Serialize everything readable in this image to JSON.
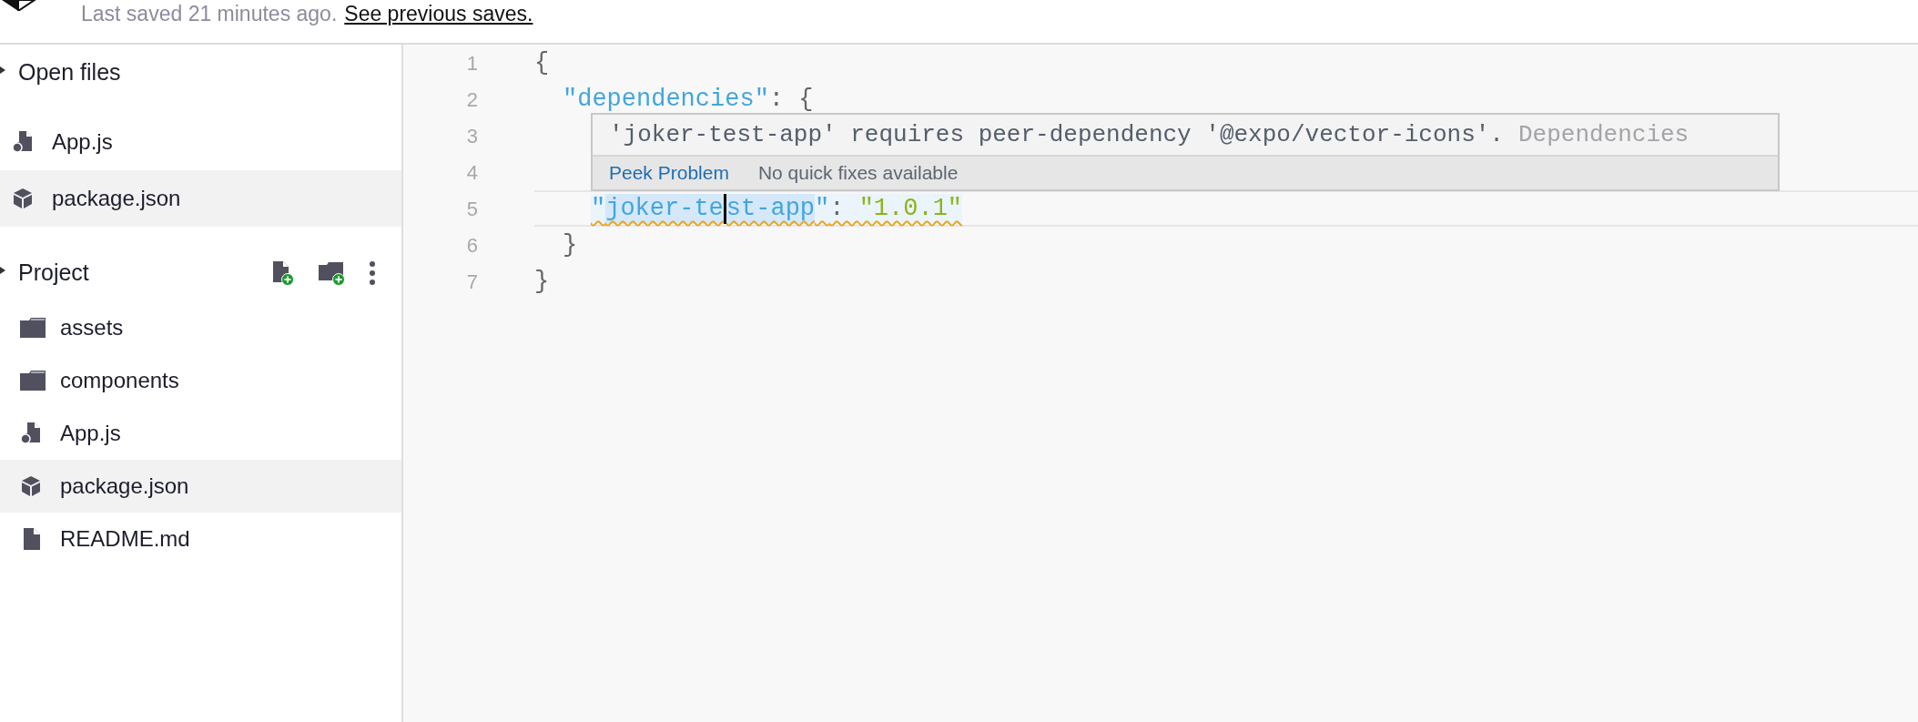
{
  "header": {
    "status": "Last saved 21 minutes ago.",
    "link": "See previous saves."
  },
  "sidebar": {
    "sections": [
      {
        "title": "Open files",
        "kind": "open_files",
        "items": [
          {
            "name": "App.js",
            "kind": "js",
            "selected": false
          },
          {
            "name": "package.json",
            "kind": "package",
            "selected": true
          }
        ]
      },
      {
        "title": "Project",
        "kind": "project",
        "items": [
          {
            "name": "assets",
            "kind": "folder",
            "selected": false
          },
          {
            "name": "components",
            "kind": "folder",
            "selected": false
          },
          {
            "name": "App.js",
            "kind": "js",
            "selected": false
          },
          {
            "name": "package.json",
            "kind": "package",
            "selected": true
          },
          {
            "name": "README.md",
            "kind": "file",
            "selected": false
          }
        ]
      }
    ]
  },
  "editor": {
    "lines": [
      {
        "number": "1",
        "current": false,
        "warning": false,
        "tokens": [
          {
            "kind": "punct",
            "text": "{"
          }
        ],
        "children": [
          {
            "number": "2",
            "current": false,
            "warning": false,
            "tokens": [
              {
                "kind": "key",
                "text": "\"dependencies\""
              },
              {
                "kind": "punct",
                "text": ": {"
              }
            ],
            "children": [
              {
                "number": "3",
                "current": false,
                "warning": false
              },
              {
                "number": "4",
                "current": false,
                "warning": false
              },
              {
                "number": "5",
                "current": true,
                "warning": true,
                "tokens": [
                  {
                    "kind": "key",
                    "text": "\"",
                    "cursor": false
                  },
                  {
                    "kind": "selection",
                    "text": "joker-te",
                    "cursor": true
                  },
                  {
                    "kind": "selection",
                    "text": "st-app",
                    "cursor": false
                  },
                  {
                    "kind": "key",
                    "text": "\"",
                    "cursor": false
                  },
                  {
                    "kind": "punct",
                    "text": ":",
                    "cursor": false
                  },
                  {
                    "kind": "value",
                    "text": "\"1.0.1\"",
                    "cursor": false
                  }
                ]
              }
            ]
          },
          {
            "number": "6",
            "current": false,
            "warning": false,
            "tokens": [
              {
                "kind": "punct",
                "text": "}"
              }
            ]
          }
        ]
      },
      {
        "number": "7",
        "current": false,
        "warning": false,
        "tokens": [
          {
            "kind": "punct",
            "text": "}"
          }
        ]
      }
    ],
    "tooltip": {
      "message": "'joker-test-app' requires peer-dependency '@expo/vector-icons'.",
      "source": "Dependencies",
      "action": "Peek Problem",
      "note": "No quick fixes available"
    }
  }
}
